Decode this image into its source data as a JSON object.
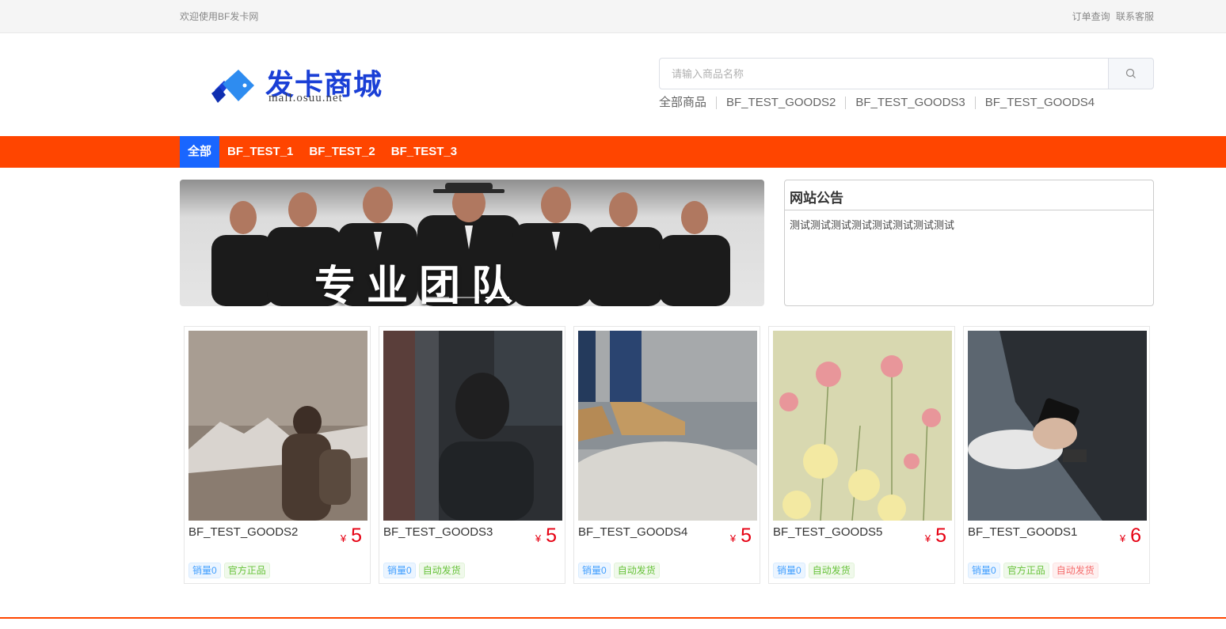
{
  "topbar": {
    "welcome": "欢迎使用BF发卡网",
    "order_query": "订单查询",
    "contact": "联系客服"
  },
  "logo": {
    "title": "发卡商城",
    "subtitle": "mall.osuu.net"
  },
  "search": {
    "placeholder": "请输入商品名称",
    "icon": "search-icon"
  },
  "quick_links": [
    "全部商品",
    "BF_TEST_GOODS2",
    "BF_TEST_GOODS3",
    "BF_TEST_GOODS4"
  ],
  "nav": [
    {
      "label": "全部",
      "active": true
    },
    {
      "label": "BF_TEST_1",
      "active": false
    },
    {
      "label": "BF_TEST_2",
      "active": false
    },
    {
      "label": "BF_TEST_3",
      "active": false
    }
  ],
  "banner": {
    "text": "专业团队",
    "slide_count": 3,
    "active_slide": 2
  },
  "notice": {
    "title": "网站公告",
    "body": "测试测试测试测试测试测试测试测试"
  },
  "goods": [
    {
      "name": "BF_TEST_GOODS2",
      "currency": "¥",
      "price": "5",
      "tags": [
        {
          "text": "销量0",
          "color": "blue"
        },
        {
          "text": "官方正品",
          "color": "green"
        }
      ]
    },
    {
      "name": "BF_TEST_GOODS3",
      "currency": "¥",
      "price": "5",
      "tags": [
        {
          "text": "销量0",
          "color": "blue"
        },
        {
          "text": "自动发货",
          "color": "green"
        }
      ]
    },
    {
      "name": "BF_TEST_GOODS4",
      "currency": "¥",
      "price": "5",
      "tags": [
        {
          "text": "销量0",
          "color": "blue"
        },
        {
          "text": "自动发货",
          "color": "green"
        }
      ]
    },
    {
      "name": "BF_TEST_GOODS5",
      "currency": "¥",
      "price": "5",
      "tags": [
        {
          "text": "销量0",
          "color": "blue"
        },
        {
          "text": "自动发货",
          "color": "green"
        }
      ]
    },
    {
      "name": "BF_TEST_GOODS1",
      "currency": "¥",
      "price": "6",
      "tags": [
        {
          "text": "销量0",
          "color": "blue"
        },
        {
          "text": "官方正品",
          "color": "green"
        },
        {
          "text": "自动发货",
          "color": "red"
        }
      ]
    }
  ],
  "colors": {
    "nav_bg": "#ff4500",
    "nav_active": "#1966ff",
    "price": "#e60012"
  }
}
